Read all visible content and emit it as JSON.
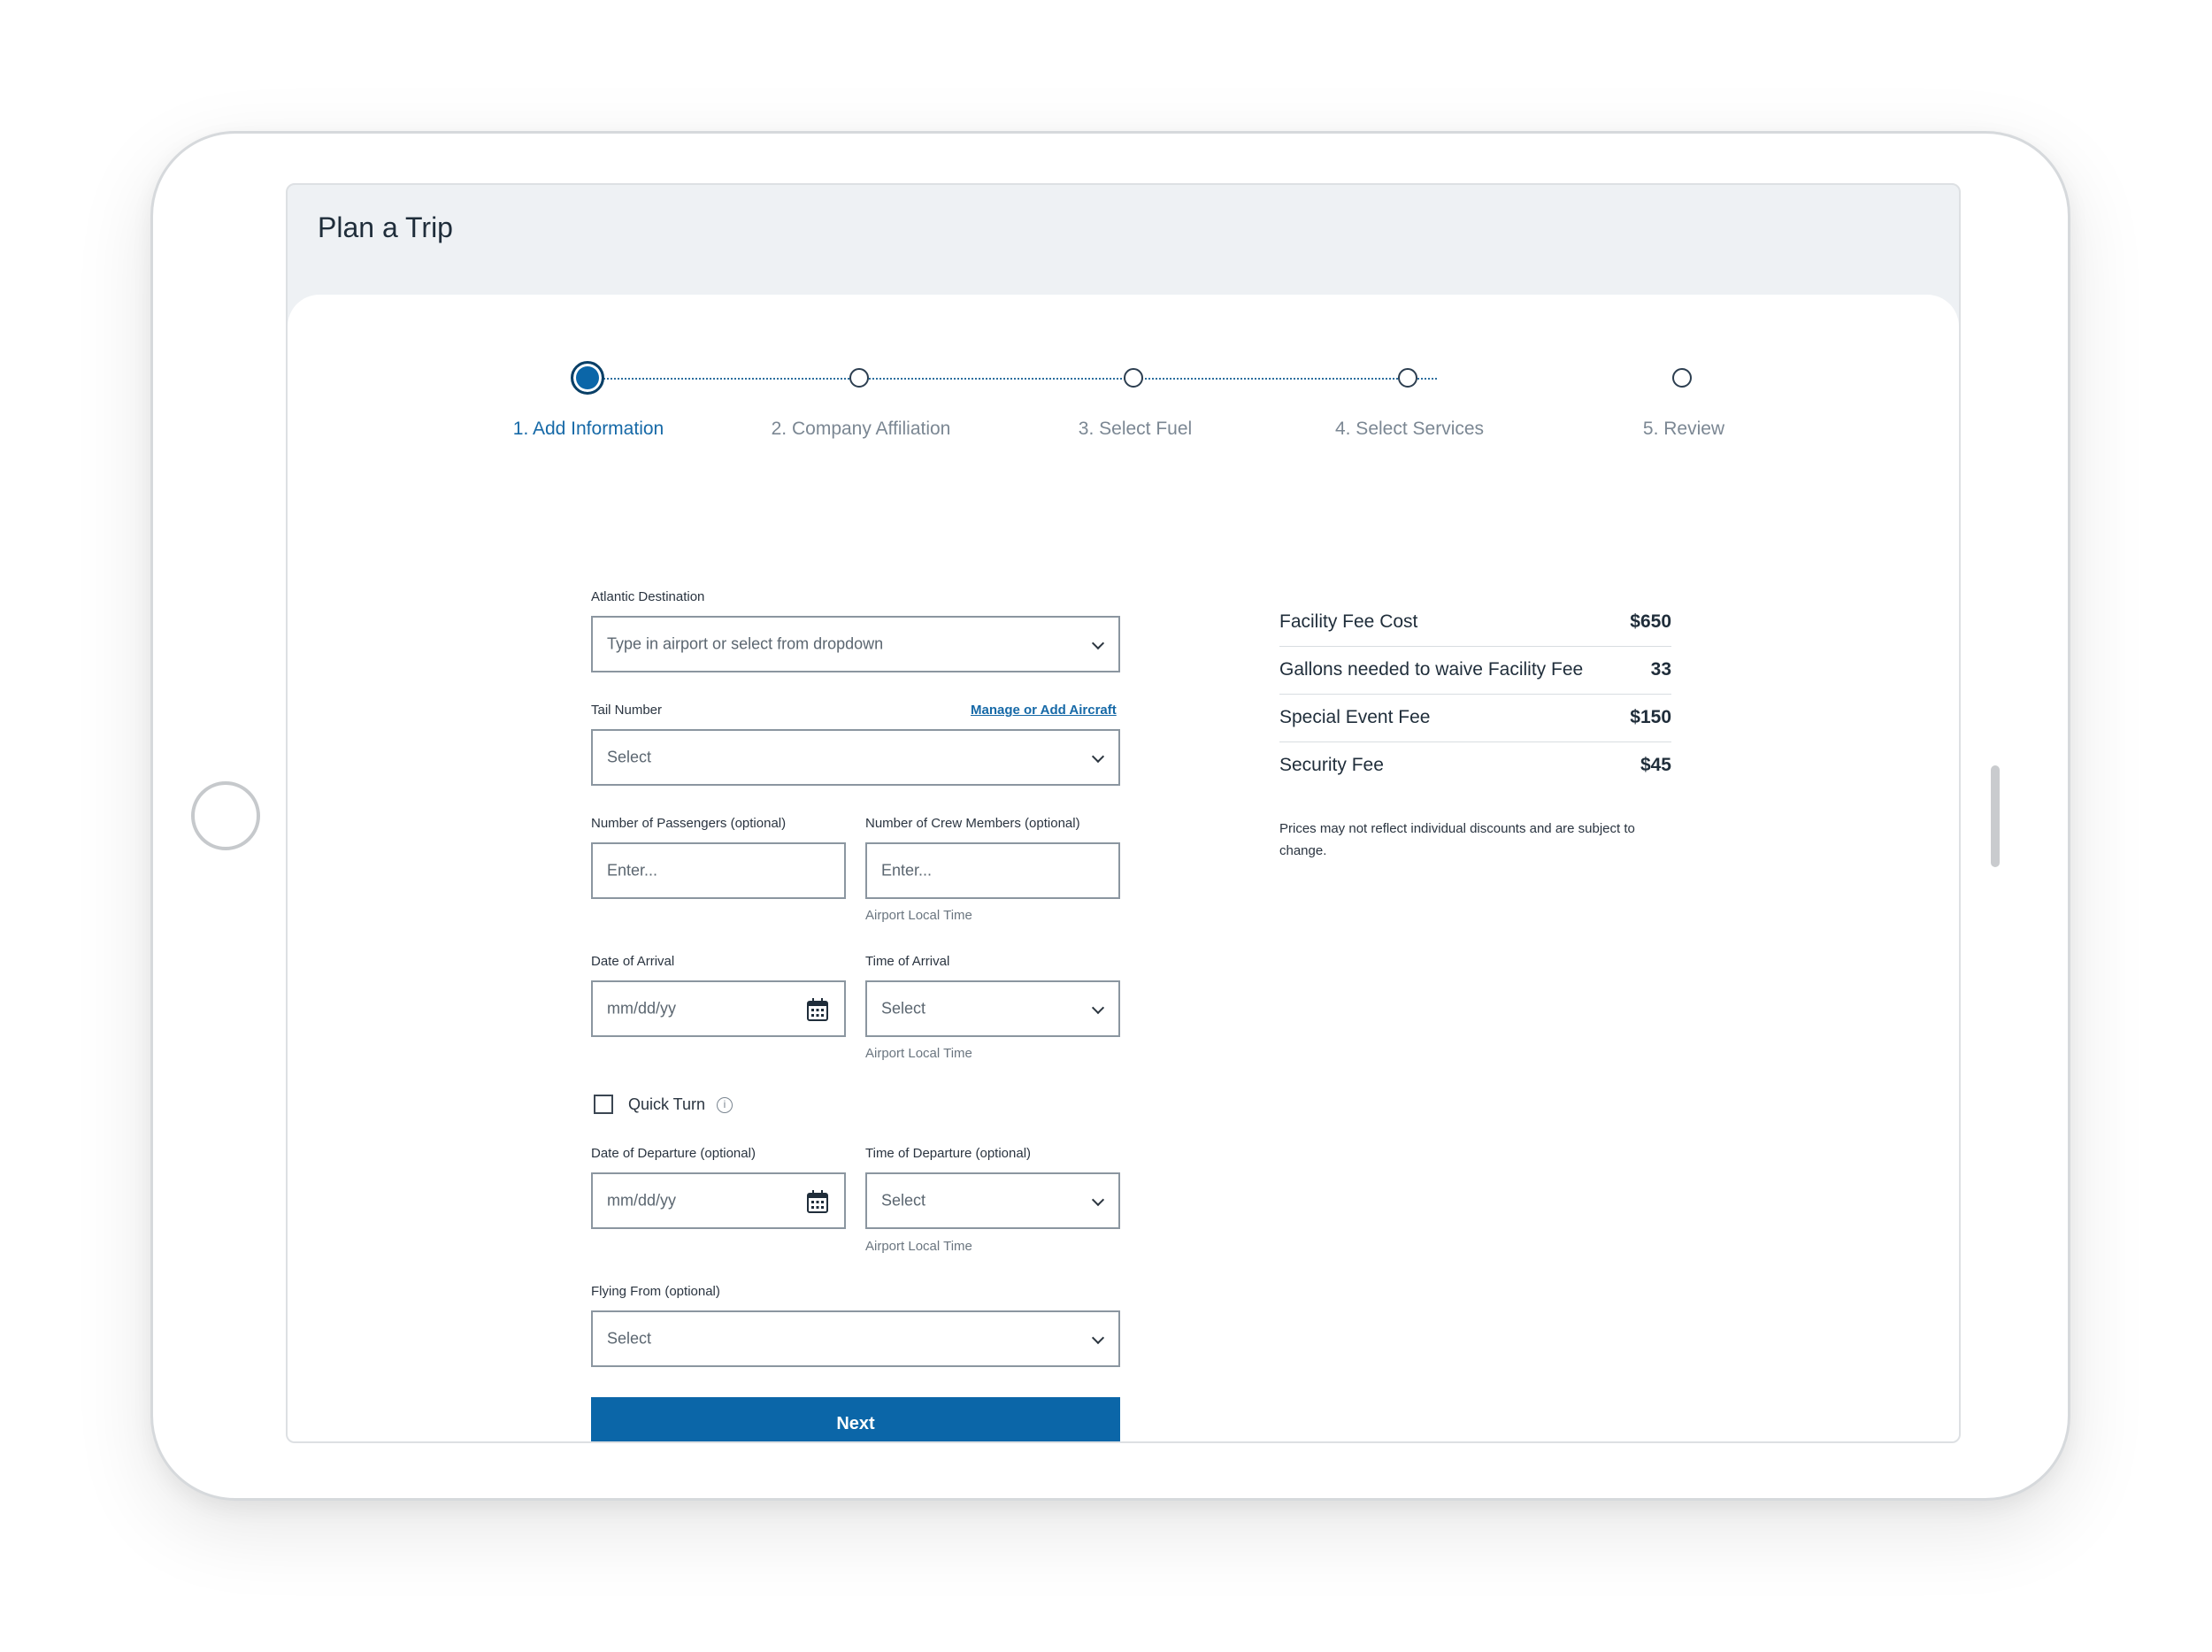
{
  "screen": {
    "title": "Plan a Trip"
  },
  "steps": [
    {
      "label": "1. Add Information",
      "active": true
    },
    {
      "label": "2. Company Affiliation",
      "active": false
    },
    {
      "label": "3. Select Fuel",
      "active": false
    },
    {
      "label": "4. Select Services",
      "active": false
    },
    {
      "label": "5. Review",
      "active": false
    }
  ],
  "form": {
    "destination": {
      "label": "Atlantic Destination",
      "placeholder": "Type in airport or select from dropdown"
    },
    "tail_number": {
      "label": "Tail Number",
      "link": "Manage or Add Aircraft",
      "value": "Select"
    },
    "passengers": {
      "label": "Number of Passengers (optional)",
      "placeholder": "Enter..."
    },
    "crew": {
      "label": "Number of Crew Members (optional)",
      "placeholder": "Enter...",
      "hint": "Airport Local Time"
    },
    "arrival_date": {
      "label": "Date of Arrival",
      "placeholder": "mm/dd/yy"
    },
    "arrival_time": {
      "label": "Time of Arrival",
      "value": "Select",
      "hint": "Airport Local Time"
    },
    "quick_turn": {
      "label": "Quick Turn",
      "info": "i"
    },
    "departure_date": {
      "label": "Date of Departure (optional)",
      "placeholder": "mm/dd/yy"
    },
    "departure_time": {
      "label": "Time of Departure (optional)",
      "value": "Select",
      "hint": "Airport Local Time"
    },
    "flying_from": {
      "label": "Flying From (optional)",
      "value": "Select"
    },
    "next_label": "Next"
  },
  "fees": [
    {
      "label": "Facility Fee Cost",
      "value": "$650"
    },
    {
      "label": "Gallons needed to waive Facility Fee",
      "value": "33"
    },
    {
      "label": "Special Event Fee",
      "value": "$150"
    },
    {
      "label": "Security Fee",
      "value": "$45"
    }
  ],
  "disclaimer": "Prices may not reflect individual discounts and are subject to change.",
  "colors": {
    "primary": "#0b66a8",
    "link": "#1669a7",
    "border": "#8b96a0"
  },
  "icons": [
    "chevron-down-icon",
    "calendar-icon",
    "info-icon",
    "home-button-icon"
  ]
}
